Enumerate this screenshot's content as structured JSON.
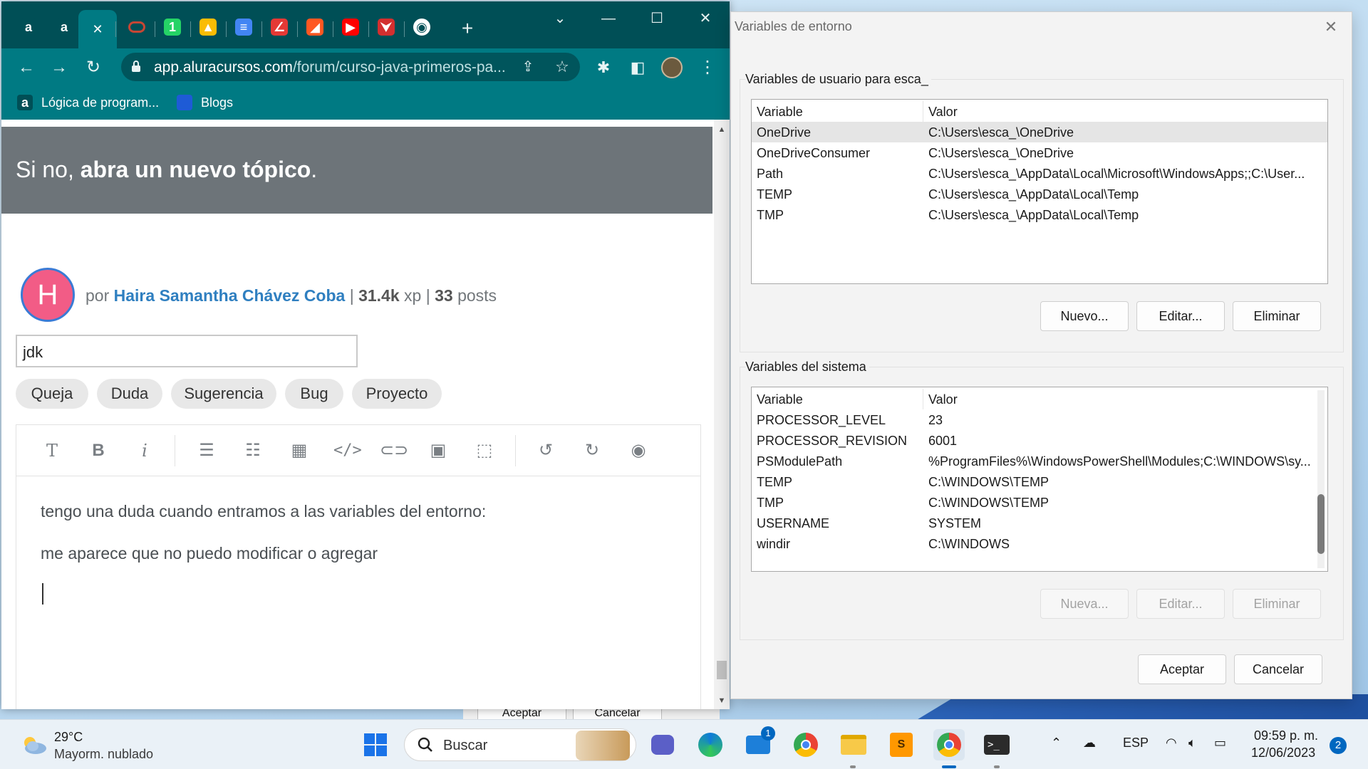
{
  "chrome": {
    "tabs": [
      {
        "name": "alura-tab-1",
        "glyph": "a",
        "color": "#004f56"
      },
      {
        "name": "alura-tab-2",
        "glyph": "a",
        "color": "#004f56"
      },
      {
        "name": "close-tab",
        "glyph": "✕",
        "color": "#007a83"
      },
      {
        "name": "oracle-tab",
        "glyph": "",
        "color": "#c74634"
      },
      {
        "name": "whatsapp-tab",
        "glyph": "1",
        "color": "#25d366"
      },
      {
        "name": "drive-tab",
        "glyph": "▲",
        "color": "#fbbc04"
      },
      {
        "name": "docs-tab",
        "glyph": "≡",
        "color": "#4285f4"
      },
      {
        "name": "extension-tab",
        "glyph": "∠",
        "color": "#e53935"
      },
      {
        "name": "office-tab",
        "glyph": "◢",
        "color": "#ff5722"
      },
      {
        "name": "youtube-tab",
        "glyph": "▶",
        "color": "#ff0000"
      },
      {
        "name": "pdf-tab",
        "glyph": "⮟",
        "color": "#d32f2f"
      },
      {
        "name": "web-tab",
        "glyph": "◉",
        "color": "#ffffff"
      }
    ],
    "new_tab": "+",
    "url_host": "app.aluracursos.com",
    "url_path": "/forum/curso-java-primeros-pa...",
    "bookmarks": [
      {
        "icon": "a",
        "label": "Lógica de program...",
        "color": "#004f56"
      },
      {
        "icon": "",
        "label": "Blogs",
        "color": "#1e5bd6"
      }
    ]
  },
  "forum": {
    "banner_prefix": "Si no, ",
    "banner_bold": "abra un nuevo tópico",
    "banner_suffix": ".",
    "avatar_letter": "H",
    "by": "por",
    "author": "Haira Samantha Chávez Coba",
    "xp_value": "31.4k",
    "xp_unit": "xp",
    "posts_value": "33",
    "posts_unit": "posts",
    "title_value": "jdk",
    "categories": [
      "Queja",
      "Duda",
      "Sugerencia",
      "Bug",
      "Proyecto"
    ],
    "editor_toolbar": {
      "text": "T",
      "bold": "B",
      "italic": "i"
    },
    "body_lines": [
      "tengo una duda cuando entramos a las variables del entorno:",
      "me aparece que no puedo modificar o agregar"
    ]
  },
  "dialog": {
    "title": "Variables de entorno",
    "user_group": "Variables de usuario para esca_",
    "system_group": "Variables del sistema",
    "col_variable": "Variable",
    "col_value": "Valor",
    "user_vars": [
      {
        "name": "OneDrive",
        "value": "C:\\Users\\esca_\\OneDrive"
      },
      {
        "name": "OneDriveConsumer",
        "value": "C:\\Users\\esca_\\OneDrive"
      },
      {
        "name": "Path",
        "value": "C:\\Users\\esca_\\AppData\\Local\\Microsoft\\WindowsApps;;C:\\User..."
      },
      {
        "name": "TEMP",
        "value": "C:\\Users\\esca_\\AppData\\Local\\Temp"
      },
      {
        "name": "TMP",
        "value": "C:\\Users\\esca_\\AppData\\Local\\Temp"
      }
    ],
    "system_vars": [
      {
        "name": "PROCESSOR_LEVEL",
        "value": "23"
      },
      {
        "name": "PROCESSOR_REVISION",
        "value": "6001"
      },
      {
        "name": "PSModulePath",
        "value": "%ProgramFiles%\\WindowsPowerShell\\Modules;C:\\WINDOWS\\sy..."
      },
      {
        "name": "TEMP",
        "value": "C:\\WINDOWS\\TEMP"
      },
      {
        "name": "TMP",
        "value": "C:\\WINDOWS\\TEMP"
      },
      {
        "name": "USERNAME",
        "value": "SYSTEM"
      },
      {
        "name": "windir",
        "value": "C:\\WINDOWS"
      }
    ],
    "user_new": "Nuevo...",
    "user_edit": "Editar...",
    "user_delete": "Eliminar",
    "sys_new": "Nueva...",
    "sys_edit": "Editar...",
    "sys_delete": "Eliminar",
    "ok": "Aceptar",
    "cancel": "Cancelar"
  },
  "behind_dialog": {
    "ok": "Aceptar",
    "cancel": "Cancelar"
  },
  "taskbar": {
    "temp": "29°C",
    "weather": "Mayorm. nublado",
    "search": "Buscar",
    "mail_badge": "1",
    "lang": "ESP",
    "time": "09:59 p. m.",
    "date": "12/06/2023",
    "notifications": "2"
  }
}
